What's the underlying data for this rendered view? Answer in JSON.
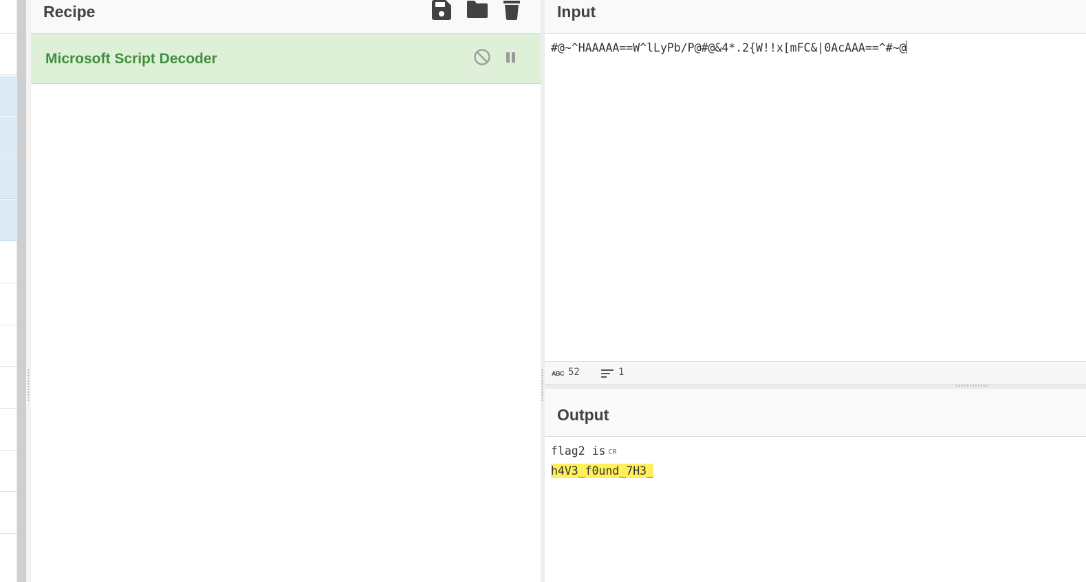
{
  "recipe": {
    "title": "Recipe",
    "operation": {
      "name": "Microsoft Script Decoder"
    }
  },
  "input": {
    "title": "Input",
    "text": "#@~^HAAAAA==W^lLyPb/P@#@&4*.2{W!!x[mFC&|0AcAAA==^#~@",
    "status": {
      "abc_label": "ABC",
      "chars": "52",
      "lines": "1"
    }
  },
  "output": {
    "title": "Output",
    "line1": "flag2 is",
    "cr_marker": "CR",
    "line2": "h4V3_f0und_7H3_"
  },
  "icons": [
    "save-icon",
    "folder-icon",
    "trash-icon",
    "disable-icon",
    "pause-icon",
    "lines-icon"
  ],
  "colors": {
    "operation_bg": "#dff0d8",
    "operation_text": "#3f8f3f",
    "highlight": "#ffef5a",
    "cr_marker": "#e03030"
  }
}
